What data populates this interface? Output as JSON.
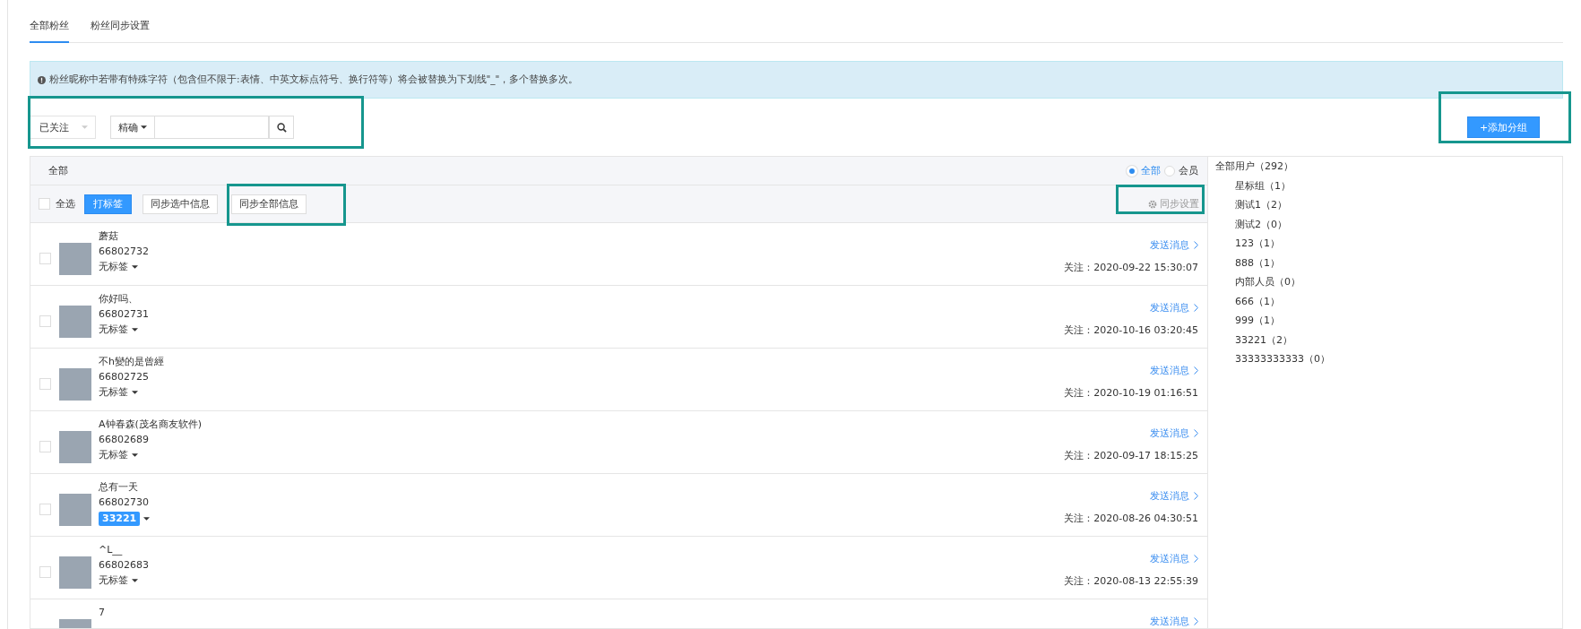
{
  "tabs": [
    {
      "label": "全部粉丝",
      "selected": true
    },
    {
      "label": "粉丝同步设置",
      "selected": false
    }
  ],
  "notice": {
    "text": "粉丝昵称中若带有特殊字符（包含但不限于:表情、中英文标点符号、换行符等）将会被替换为下划线\"_\"，多个替换多次。"
  },
  "filter": {
    "status": "已关注",
    "mode": "精确"
  },
  "add_group_button": "+添加分组",
  "list_header": {
    "title": "全部",
    "options": [
      {
        "label": "全部",
        "selected": true
      },
      {
        "label": "会员",
        "selected": false
      }
    ]
  },
  "toolbar": {
    "select_all": {
      "label": "全选",
      "checked": false
    },
    "tag_button": "打标签",
    "sync_selected_button": "同步选中信息",
    "sync_all_button": "同步全部信息",
    "sync_settings": "同步设置"
  },
  "fans": [
    {
      "name": "蘑菇",
      "id": "66802732",
      "tag": {
        "kind": "none",
        "text": "无标签"
      },
      "checked": false,
      "link": "发送消息",
      "followed": "关注：2020-09-22 15:30:07"
    },
    {
      "name": "你好吗、",
      "id": "66802731",
      "tag": {
        "kind": "none",
        "text": "无标签"
      },
      "checked": false,
      "link": "发送消息",
      "followed": "关注：2020-10-16 03:20:45"
    },
    {
      "name": "不h變的是曾經",
      "id": "66802725",
      "tag": {
        "kind": "none",
        "text": "无标签"
      },
      "checked": false,
      "link": "发送消息",
      "followed": "关注：2020-10-19 01:16:51"
    },
    {
      "name": "A钟春森(茂名商友软件)",
      "id": "66802689",
      "tag": {
        "kind": "none",
        "text": "无标签"
      },
      "checked": false,
      "link": "发送消息",
      "followed": "关注：2020-09-17 18:15:25"
    },
    {
      "name": "总有一天",
      "id": "66802730",
      "tag": {
        "kind": "badge",
        "text": "33221"
      },
      "checked": false,
      "link": "发送消息",
      "followed": "关注：2020-08-26 04:30:51"
    },
    {
      "name": "^L__",
      "id": "66802683",
      "tag": {
        "kind": "none",
        "text": "无标签"
      },
      "checked": false,
      "link": "发送消息",
      "followed": "关注：2020-08-13 22:55:39"
    },
    {
      "name": "7",
      "link": "发送消息"
    }
  ],
  "groups": {
    "label": "全部用户（292）",
    "children": [
      {
        "label": "星标组（1）"
      },
      {
        "label": "测试1（2）"
      },
      {
        "label": "测试2（0）"
      },
      {
        "label": "123（1）"
      },
      {
        "label": "888（1）"
      },
      {
        "label": "内部人员（0）"
      },
      {
        "label": "666（1）"
      },
      {
        "label": "999（1）"
      },
      {
        "label": "33221（2）"
      },
      {
        "label": "33333333333（0）"
      }
    ]
  }
}
